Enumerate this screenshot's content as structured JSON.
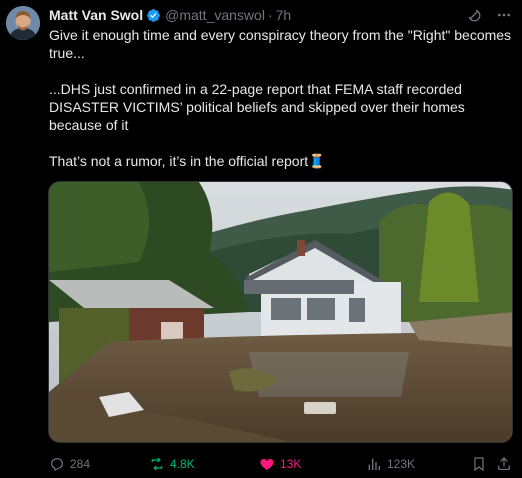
{
  "author": {
    "name": "Matt Van Swol",
    "handle": "@matt_vanswol",
    "separator": "·",
    "time": "7h"
  },
  "tweet": {
    "paragraphs": [
      "Give it enough time and every conspiracy theory from the \"Right\" becomes true...",
      "...DHS just confirmed in a 22-page report that FEMA staff recorded DISASTER VICTIMS’ political beliefs and skipped over their homes because of it",
      "That’s not a rumor, it’s in the official report🧵"
    ]
  },
  "actions": {
    "replies": "284",
    "reposts": "4.8K",
    "likes": "13K",
    "views": "123K"
  },
  "colors": {
    "background": "#000000",
    "text": "#e7e9ea",
    "muted": "#71767b",
    "verified": "#1d9bf0",
    "repost_active": "#00ba7c",
    "like_active": "#f91880"
  },
  "icons": [
    "verified-badge-icon",
    "grok-icon",
    "more-icon",
    "reply-icon",
    "repost-icon",
    "like-icon",
    "views-icon",
    "bookmark-icon",
    "share-icon"
  ]
}
